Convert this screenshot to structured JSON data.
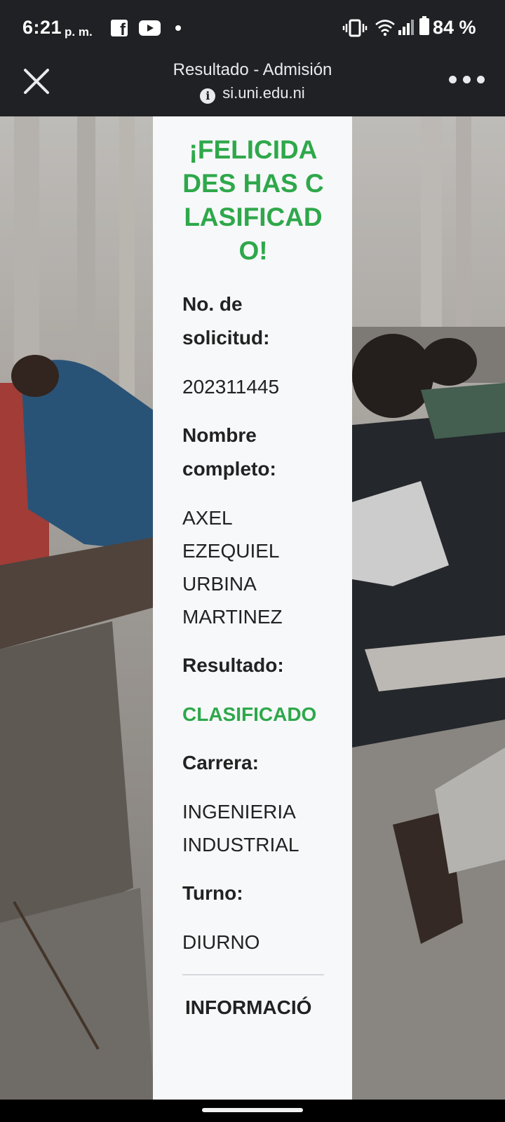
{
  "status_bar": {
    "time": "6:21",
    "ampm": "p. m.",
    "notification_icons": [
      "facebook-icon",
      "youtube-icon",
      "more-notifications-dot"
    ],
    "system_icons": [
      "vibrate-icon",
      "wifi-icon",
      "signal-icon",
      "battery-icon"
    ],
    "battery": "84 %"
  },
  "toolbar": {
    "title": "Resultado - Admisión",
    "url": "si.uni.edu.ni",
    "close_icon": "close-icon",
    "menu_icon": "more-horizontal-icon"
  },
  "result": {
    "headline": "¡FELICIDADES HAS CLASIFICADO!",
    "fields": {
      "solicitud": {
        "label": "No. de solicitud:",
        "value": "202311445"
      },
      "nombre": {
        "label": "Nombre completo:",
        "value": "AXEL EZEQUIEL URBINA MARTINEZ"
      },
      "resultado": {
        "label": "Resultado:",
        "value": "CLASIFICADO"
      },
      "carrera": {
        "label": "Carrera:",
        "value": "INGENIERIA INDUSTRIAL"
      },
      "turno": {
        "label": "Turno:",
        "value": "DIURNO"
      }
    },
    "section_title": "INFORMACIÓ"
  },
  "colors": {
    "accent_green": "#2ea84a",
    "chrome_dark": "#202124",
    "card_bg": "#f7f8fa"
  }
}
